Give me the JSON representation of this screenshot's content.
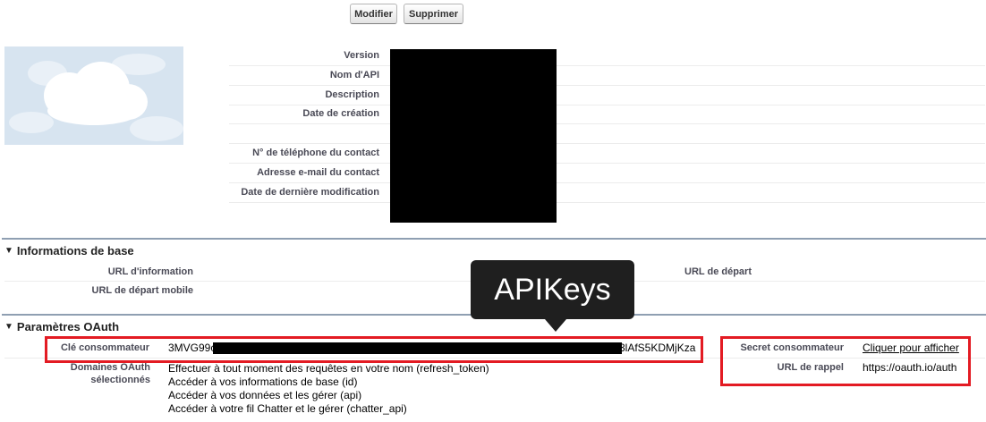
{
  "toolbar": {
    "edit_label": "Modifier",
    "delete_label": "Supprimer"
  },
  "detail": {
    "labels": [
      "Version",
      "Nom d'API",
      "Description",
      "Date de création",
      "",
      "N° de téléphone du contact",
      "Adresse e-mail du contact",
      "Date de dernière modification"
    ]
  },
  "sections": {
    "basic": {
      "title": "Informations de base",
      "info_url_label": "URL d'information",
      "start_url_label": "URL de départ",
      "mobile_start_url_label": "URL de départ mobile"
    },
    "oauth": {
      "title": "Paramètres OAuth",
      "consumer_key_label": "Clé consommateur",
      "consumer_key_prefix": "3MVG99c",
      "consumer_key_suffix": "3lAfS5KDMjKza",
      "consumer_secret_label": "Secret consommateur",
      "consumer_secret_link": "Cliquer pour afficher",
      "callback_url_label": "URL de rappel",
      "callback_url_value": "https://oauth.io/auth",
      "scopes_label_line1": "Domaines OAuth",
      "scopes_label_line2": "sélectionnés",
      "scopes": [
        "Effectuer à tout moment des requêtes en votre nom (refresh_token)",
        "Accéder à vos informations de base (id)",
        "Accéder à vos données et les gérer (api)",
        "Accéder à votre fil Chatter et le gérer (chatter_api)"
      ]
    }
  },
  "annotation": {
    "tooltip_text": "APIKeys",
    "highlight_color": "#e31b23"
  }
}
